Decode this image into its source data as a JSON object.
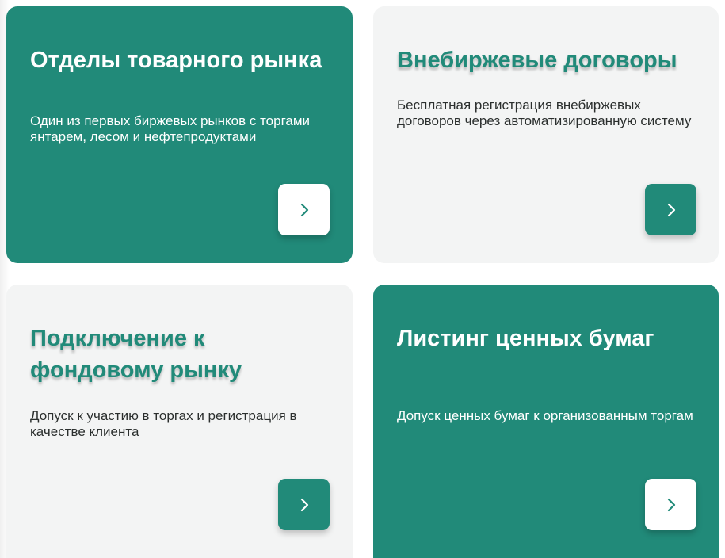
{
  "cards": [
    {
      "title": "Отделы товарного рынка",
      "description": "Один из первых биржевых рынков с торгами янтарем, лесом и нефтепродуктами",
      "style": "green",
      "button_icon": "chevron-right-icon"
    },
    {
      "title": "Внебиржевые договоры",
      "description": "Бесплатная регистрация внебиржевых договоров через автоматизированную систему",
      "style": "light",
      "button_icon": "chevron-right-icon"
    },
    {
      "title": "Подключение к фондовому рынку",
      "description": "Допуск к участию в торгах и регистрация в качестве клиента",
      "style": "light",
      "button_icon": "chevron-right-icon"
    },
    {
      "title": "Листинг ценных бумаг",
      "description": "Допуск ценных бумаг к организованным торгам",
      "style": "green",
      "button_icon": "chevron-right-icon"
    }
  ],
  "colors": {
    "accent": "#218a79",
    "light_card": "#f3f4f4",
    "white": "#ffffff"
  }
}
